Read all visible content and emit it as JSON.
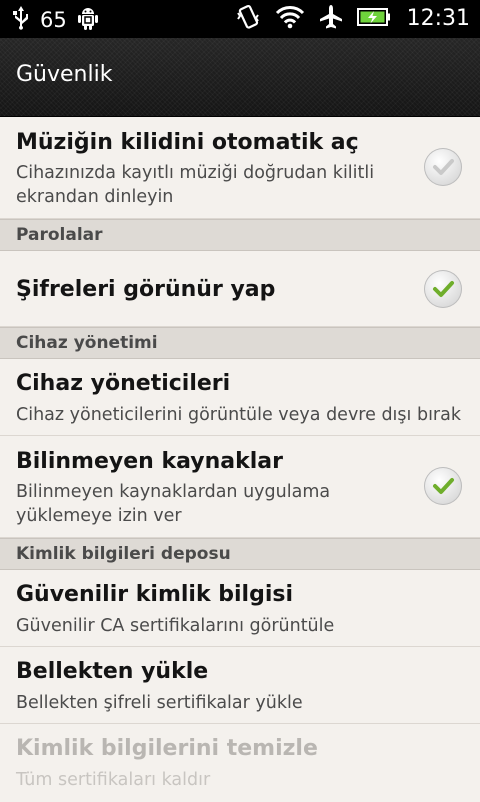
{
  "status_bar": {
    "battery_percent": "65",
    "time": "12:31",
    "icons": [
      "usb-icon",
      "android-debug-icon",
      "vibrate-icon",
      "wifi-icon",
      "airplane-icon",
      "battery-charging-icon"
    ]
  },
  "title_bar": {
    "title": "Güvenlik"
  },
  "items": [
    {
      "title": "Müziğin kilidini otomatik aç",
      "subtitle": "Cihazınızda kayıtlı müziği doğrudan kilitli ekrandan dinleyin",
      "checked": false
    },
    {
      "section": "Parolalar"
    },
    {
      "title": "Şifreleri görünür yap",
      "checked": true
    },
    {
      "section": "Cihaz yönetimi"
    },
    {
      "title": "Cihaz yöneticileri",
      "subtitle": "Cihaz yöneticilerini görüntüle veya devre dışı bırak"
    },
    {
      "title": "Bilinmeyen kaynaklar",
      "subtitle": "Bilinmeyen kaynaklardan uygulama yüklemeye izin ver",
      "checked": true
    },
    {
      "section": "Kimlik bilgileri deposu"
    },
    {
      "title": "Güvenilir kimlik bilgisi",
      "subtitle": "Güvenilir CA sertifikalarını görüntüle"
    },
    {
      "title": "Bellekten yükle",
      "subtitle": "Bellekten şifreli sertifikalar yükle"
    },
    {
      "title": "Kimlik bilgilerini temizle",
      "subtitle": "Tüm sertifikaları kaldır",
      "disabled": true
    }
  ],
  "colors": {
    "checkmark_active": "#6fae2c",
    "checkmark_inactive": "#c9c9c9",
    "section_bg": "#dedad5",
    "list_bg": "#f4f1ed"
  }
}
